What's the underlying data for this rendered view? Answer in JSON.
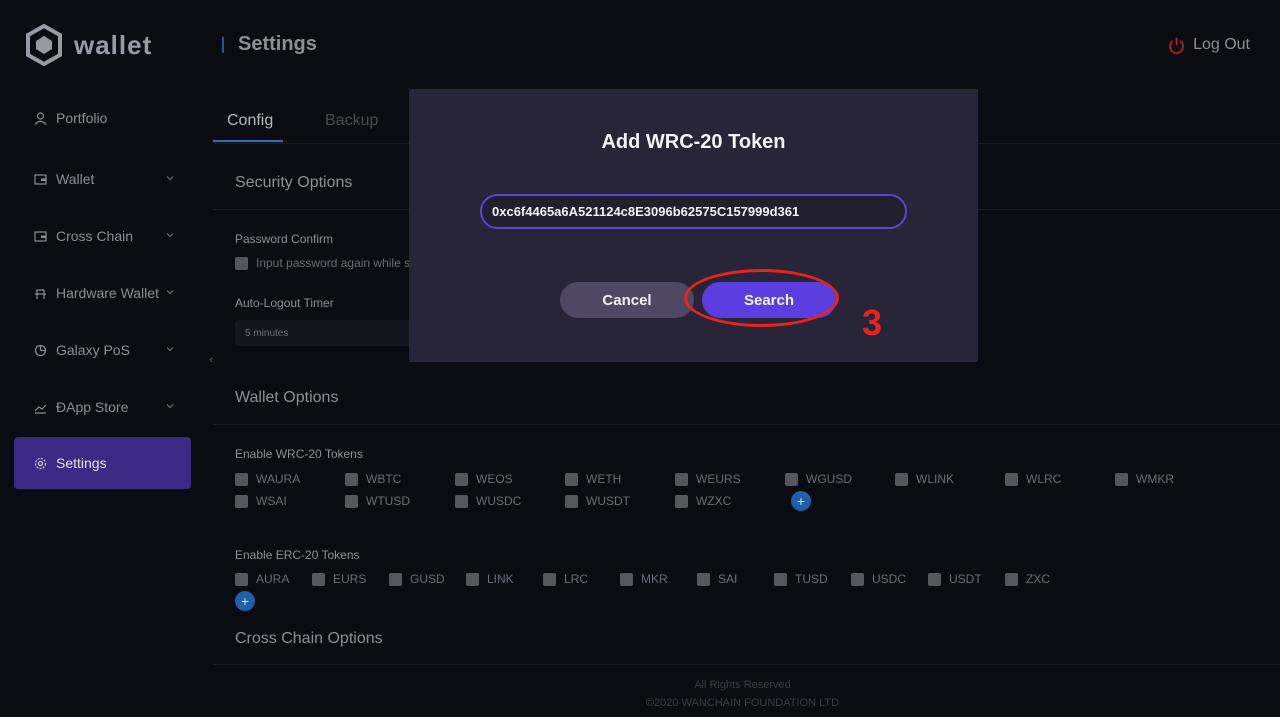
{
  "app": {
    "logo_text": "wallet"
  },
  "sidebar": {
    "items": [
      {
        "label": "Portfolio",
        "icon": "user-icon"
      },
      {
        "label": "Wallet",
        "icon": "wallet-icon"
      },
      {
        "label": "Cross Chain",
        "icon": "wallet-icon"
      },
      {
        "label": "Hardware Wallet",
        "icon": "hardware-icon"
      },
      {
        "label": "Galaxy PoS",
        "icon": "pie-chart-icon"
      },
      {
        "label": "ĐApp Store",
        "icon": "line-chart-icon"
      },
      {
        "label": "Settings",
        "icon": "gear-icon",
        "active": true
      }
    ],
    "collapse_glyph": "‹"
  },
  "header": {
    "title": "Settings",
    "logout_label": "Log Out"
  },
  "tabs": [
    {
      "label": "Config",
      "active": true
    },
    {
      "label": "Backup",
      "active": false
    }
  ],
  "security": {
    "title": "Security Options",
    "password_confirm_label": "Password Confirm",
    "password_confirm_option": "Input password again while sen",
    "auto_logout_label": "Auto-Logout Timer",
    "auto_logout_value": "5 minutes"
  },
  "wallet_options": {
    "title": "Wallet Options",
    "wrc20_label": "Enable WRC-20 Tokens",
    "wrc20_tokens": [
      "WAURA",
      "WBTC",
      "WEOS",
      "WETH",
      "WEURS",
      "WGUSD",
      "WLINK",
      "WLRC",
      "WMKR",
      "WSAI",
      "WTUSD",
      "WUSDC",
      "WUSDT",
      "WZXC"
    ],
    "erc20_label": "Enable ERC-20 Tokens",
    "erc20_tokens": [
      "AURA",
      "EURS",
      "GUSD",
      "LINK",
      "LRC",
      "MKR",
      "SAI",
      "TUSD",
      "USDC",
      "USDT",
      "ZXC"
    ],
    "add_glyph": "+"
  },
  "cross_chain": {
    "title": "Cross Chain Options"
  },
  "footer": {
    "line1": "All Rights Reserved",
    "line2": "©2020 WANCHAIN FOUNDATION LTD"
  },
  "modal": {
    "title": "Add WRC-20 Token",
    "input_value": "0xc6f4465a6A521124c8E3096b62575C157999d361",
    "cancel_label": "Cancel",
    "search_label": "Search"
  },
  "annotation": {
    "step_number": "3",
    "color": "#e8231c"
  },
  "colors": {
    "accent": "#5a3ee0",
    "active_nav": "#3b2a85",
    "modal_bg": "#292538",
    "plus": "#1e5faa"
  }
}
